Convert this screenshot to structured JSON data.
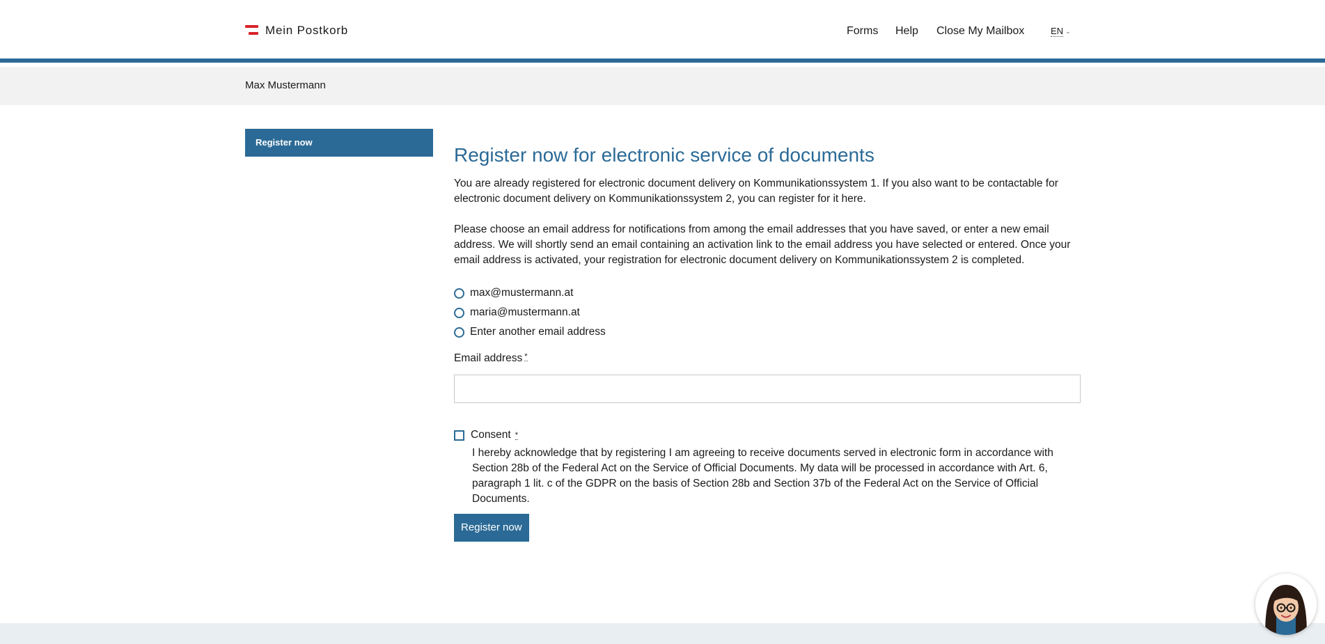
{
  "header": {
    "app_title": "Mein Postkorb",
    "nav": [
      {
        "label": "Forms"
      },
      {
        "label": "Help"
      },
      {
        "label": "Close My Mailbox"
      }
    ],
    "language": "EN"
  },
  "userbar": {
    "user_name": "Max Mustermann"
  },
  "sidebar": {
    "items": [
      {
        "label": "Register now",
        "active": true
      }
    ]
  },
  "main": {
    "title": "Register now for electronic service of documents",
    "intro": "You are already registered for electronic document delivery on Kommunikationssystem 1. If you also want to be contactable for electronic document delivery on Kommunikationssystem 2, you can register for it here.",
    "instructions": "Please choose an email address for notifications from among the email addresses that you have saved, or enter a new email address. We will shortly send an email containing an activation link to the email address you have selected or entered. Once your email address is activated, your registration for electronic document delivery on Kommunikationssystem 2 is completed.",
    "email_options": [
      {
        "label": "max@mustermann.at",
        "selected": false
      },
      {
        "label": "maria@mustermann.at",
        "selected": false
      },
      {
        "label": "Enter another email address",
        "selected": false
      }
    ],
    "email_field": {
      "label": "Email address",
      "required_marker": "*",
      "value": ""
    },
    "consent": {
      "label": "Consent",
      "required_marker": "*",
      "checked": false,
      "text": "I hereby acknowledge that by registering I am agreeing to receive documents served in electronic form in accordance with Section 28b of the Federal Act on the Service of Official Documents. My data will be processed in accordance with Art. 6, paragraph 1 lit. c of the GDPR on the basis of Section 28b and Section 37b of the Federal Act on the Service of Official Documents."
    },
    "submit_label": "Register now"
  },
  "colors": {
    "accent": "#2b6a96",
    "brand_red": "#d8232a",
    "userbar_bg": "#f2f2f2",
    "footer_bg": "#e8eef2"
  },
  "icons": {
    "logo": "austria-flag-logo-icon",
    "language_dropdown": "chevron-down-icon",
    "assistant": "assistant-avatar-icon"
  }
}
